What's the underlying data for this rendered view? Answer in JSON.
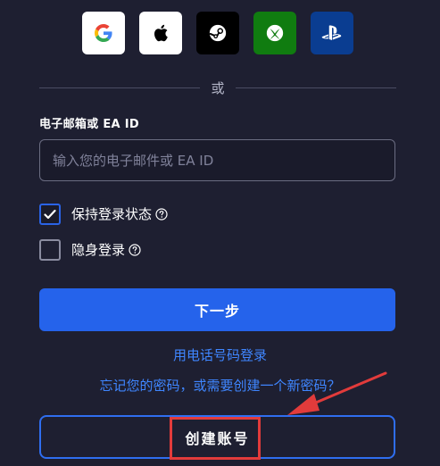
{
  "social": {
    "buttons": [
      {
        "name": "google",
        "icon": "google-icon",
        "bg": "#ffffff"
      },
      {
        "name": "apple",
        "icon": "apple-icon",
        "bg": "#ffffff"
      },
      {
        "name": "steam",
        "icon": "steam-icon",
        "bg": "#000000"
      },
      {
        "name": "xbox",
        "icon": "xbox-icon",
        "bg": "#107c10"
      },
      {
        "name": "playstation",
        "icon": "playstation-icon",
        "bg": "#0a3d91"
      }
    ]
  },
  "divider": {
    "text": "或"
  },
  "email": {
    "label": "电子邮箱或 EA ID",
    "value": "",
    "placeholder": "输入您的电子邮件或 EA ID"
  },
  "options": {
    "remember": {
      "label": "保持登录状态",
      "checked": true
    },
    "invisible": {
      "label": "隐身登录",
      "checked": false
    }
  },
  "actions": {
    "next_label": "下一步",
    "phone_login_label": "用电话号码登录",
    "forgot_label": "忘记您的密码，或需要创建一个新密码？",
    "create_account_label": "创建账号"
  },
  "colors": {
    "background": "#1e1f31",
    "primary": "#2563eb",
    "link": "#3f86ff",
    "annotation": "#e23b3b"
  }
}
